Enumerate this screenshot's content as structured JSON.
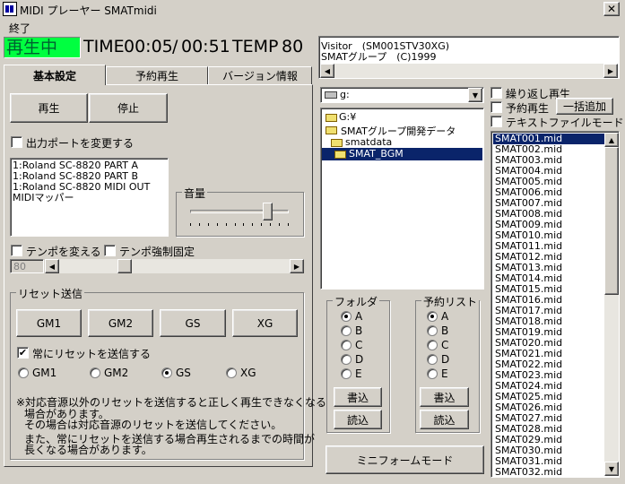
{
  "window": {
    "title": "MIDI プレーヤー SMATmidi",
    "close": "✕"
  },
  "menu": {
    "exit": "終了"
  },
  "status": {
    "state": "再生中",
    "time_label": "TIME",
    "time_current": "00:05",
    "time_sep": "/",
    "time_total": "00:51",
    "tempo_label": "TEMP",
    "tempo_value": "80"
  },
  "tabs": [
    "基本設定",
    "予約再生",
    "バージョン情報"
  ],
  "buttons": {
    "play": "再生",
    "stop": "停止"
  },
  "output_port": {
    "label": "出力ポートを変更する",
    "checked": false,
    "items": [
      "1:Roland SC-8820 PART A",
      "1:Roland SC-8820 PART B",
      "1:Roland SC-8820 MIDI OUT",
      "MIDIマッパー"
    ]
  },
  "volume": {
    "label": "音量",
    "level": 0.78
  },
  "tempo": {
    "change_label": "テンポを変える",
    "force_label": "テンポ強制固定",
    "value": "80",
    "slider": 0.27
  },
  "reset": {
    "group_label": "リセット送信",
    "buttons": [
      "GM1",
      "GM2",
      "GS",
      "XG"
    ],
    "always_label": "常にリセットを送信する",
    "always_checked": true,
    "radios": [
      "GM1",
      "GM2",
      "GS",
      "XG"
    ],
    "selected": "GS",
    "note_line1": "※対応音源以外のリセットを送信すると正しく再生できなくなる",
    "note_line2": "場合があります。",
    "note_line3": "その場合は対応音源のリセットを送信してください。",
    "note_line4": "また、常にリセットを送信する場合再生されるまでの時間が",
    "note_line5": "長くなる場合があります。"
  },
  "info": {
    "line1": "Visitor　(SM001STV30XG)",
    "line2": "SMATグループ　(C)1999"
  },
  "drive": {
    "value": "g:"
  },
  "folders": [
    "G:¥",
    "SMATグループ開発データ",
    "smatdata",
    "SMAT_BGM"
  ],
  "folder_group": {
    "label": "フォルダ",
    "options": [
      "A",
      "B",
      "C",
      "D",
      "E"
    ],
    "selected": "A",
    "write": "書込",
    "read": "読込"
  },
  "reserve_group": {
    "label": "予約リスト",
    "options": [
      "A",
      "B",
      "C",
      "D",
      "E"
    ],
    "selected": "A",
    "write": "書込",
    "read": "読込"
  },
  "mini_button": "ミニフォームモード",
  "options": {
    "repeat": "繰り返し再生",
    "reserve": "予約再生",
    "bulk_add": "一括追加",
    "text_mode": "テキストファイルモード"
  },
  "files": [
    "SMAT001.mid",
    "SMAT002.mid",
    "SMAT003.mid",
    "SMAT004.mid",
    "SMAT005.mid",
    "SMAT006.mid",
    "SMAT007.mid",
    "SMAT008.mid",
    "SMAT009.mid",
    "SMAT010.mid",
    "SMAT011.mid",
    "SMAT012.mid",
    "SMAT013.mid",
    "SMAT014.mid",
    "SMAT015.mid",
    "SMAT016.mid",
    "SMAT017.mid",
    "SMAT018.mid",
    "SMAT019.mid",
    "SMAT020.mid",
    "SMAT021.mid",
    "SMAT022.mid",
    "SMAT023.mid",
    "SMAT024.mid",
    "SMAT025.mid",
    "SMAT026.mid",
    "SMAT027.mid",
    "SMAT028.mid",
    "SMAT029.mid",
    "SMAT030.mid",
    "SMAT031.mid",
    "SMAT032.mid"
  ],
  "colors": {
    "titlebar": "#0a246a",
    "status_bg": "#00ff40",
    "select": "#0a246a"
  }
}
